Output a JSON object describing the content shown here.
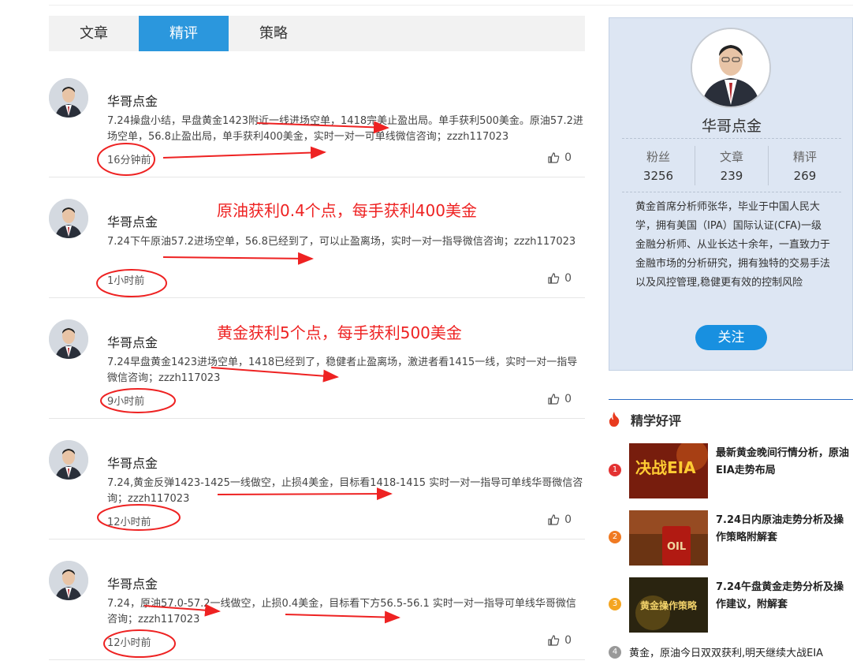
{
  "tabs": [
    "文章",
    "精评",
    "策略"
  ],
  "active_tab": 1,
  "posts": [
    {
      "author": "华哥点金",
      "content": "7.24操盘小结，早盘黄金1423附近一线进场空单，1418完美止盈出局。单手获利500美金。原油57.2进场空单，56.8止盈出局，单手获利400美金，实时一对一可单线微信咨询；zzzh117023",
      "time": "16分钟前",
      "likes": "0"
    },
    {
      "author": "华哥点金",
      "content": "7.24下午原油57.2进场空单，56.8已经到了，可以止盈离场，实时一对一指导微信咨询；zzzh117023",
      "time": "1小时前",
      "likes": "0"
    },
    {
      "author": "华哥点金",
      "content": "7.24早盘黄金1423进场空单，1418已经到了，稳健者止盈离场，激进者看1415一线，实时一对一指导微信咨询；zzzh117023",
      "time": "9小时前",
      "likes": "0"
    },
    {
      "author": "华哥点金",
      "content": "7.24,黄金反弹1423-1425一线做空，止损4美金，目标看1418-1415 实时一对一指导可单线华哥微信咨询；zzzh117023",
      "time": "12小时前",
      "likes": "0"
    },
    {
      "author": "华哥点金",
      "content": "7.24，原油57.0-57.2一线做空，止损0.4美金，目标看下方56.5-56.1 实时一对一指导可单线华哥微信咨询；zzzh117023",
      "time": "12小时前",
      "likes": "0"
    }
  ],
  "annotations": {
    "oil": "原油获利0.4个点，每手获利400美金",
    "gold": "黄金获利5个点，每手获利500美金"
  },
  "profile": {
    "name": "华哥点金",
    "stats": [
      {
        "label": "粉丝",
        "value": "3256"
      },
      {
        "label": "文章",
        "value": "239"
      },
      {
        "label": "精评",
        "value": "269"
      }
    ],
    "bio": "黄金首席分析师张华，毕业于中国人民大学，拥有美国（IPA）国际认证(CFA)一级金融分析师、从业长达十余年，一直致力于金融市场的分析研究，拥有独特的交易手法以及风控管理,稳健更有效的控制风险",
    "follow_label": "关注"
  },
  "picks": {
    "title": "精学好评",
    "items": [
      {
        "num": "1",
        "title": "最新黄金晚间行情分析，原油EIA走势布局",
        "color": "#e33232",
        "thumb_text": "决战EIA"
      },
      {
        "num": "2",
        "title": "7.24日内原油走势分析及操作策略附解套",
        "color": "#f07a22",
        "thumb_text": "OIL"
      },
      {
        "num": "3",
        "title": "7.24午盘黄金走势分析及操作建议，附解套",
        "color": "#f4a521",
        "thumb_text": "黄金操作策略"
      }
    ],
    "last": {
      "num": "4",
      "title": "黄金，原油今日双双获利,明天继续大战EIA"
    }
  },
  "colors": {
    "accent": "#2b97dd",
    "annotation": "#ee2222"
  }
}
